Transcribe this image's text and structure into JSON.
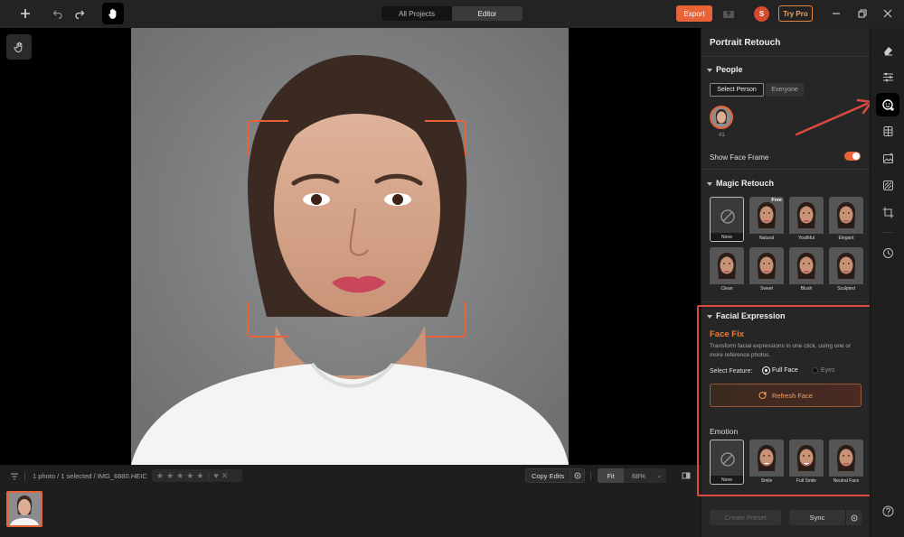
{
  "topbar": {
    "tabs": [
      {
        "label": "All Projects"
      },
      {
        "label": "Editor"
      }
    ],
    "export_label": "Export",
    "avatar_initial": "S",
    "try_pro_label": "Try Pro"
  },
  "panel": {
    "title": "Portrait Retouch",
    "people": {
      "heading": "People",
      "select_person_label": "Select Person",
      "everyone_label": "Everyone",
      "person_tag": "#1",
      "show_face_frame_label": "Show Face Frame"
    },
    "magic_retouch": {
      "heading": "Magic Retouch",
      "free_badge": "Free",
      "presets": [
        "None",
        "Natural",
        "Youthful",
        "Elegant",
        "Clean",
        "Sweet",
        "Blush",
        "Sculpted"
      ]
    },
    "facial_expression": {
      "heading": "Facial Expression",
      "face_fix_title": "Face Fix",
      "face_fix_desc": "Transform facial expressions in one click, using one or more reference photos.",
      "select_feature_label": "Select Feature:",
      "options": [
        "Full Face",
        "Eyes"
      ],
      "refresh_label": "Refresh Face",
      "emotion_label": "Emotion",
      "emotions": [
        "None",
        "Smile",
        "Full Smile",
        "Neutral Face"
      ]
    },
    "footer": {
      "create_preset_label": "Create Preset",
      "sync_label": "Sync"
    }
  },
  "bottombar": {
    "status_text": "1 photo / 1 selected / IMG_6880.HEIC",
    "copy_edits_label": "Copy Edits",
    "fit_label": "Fit",
    "zoom_value": "68%"
  },
  "colors": {
    "accent": "#e8623a",
    "highlight": "#d94a3f"
  }
}
